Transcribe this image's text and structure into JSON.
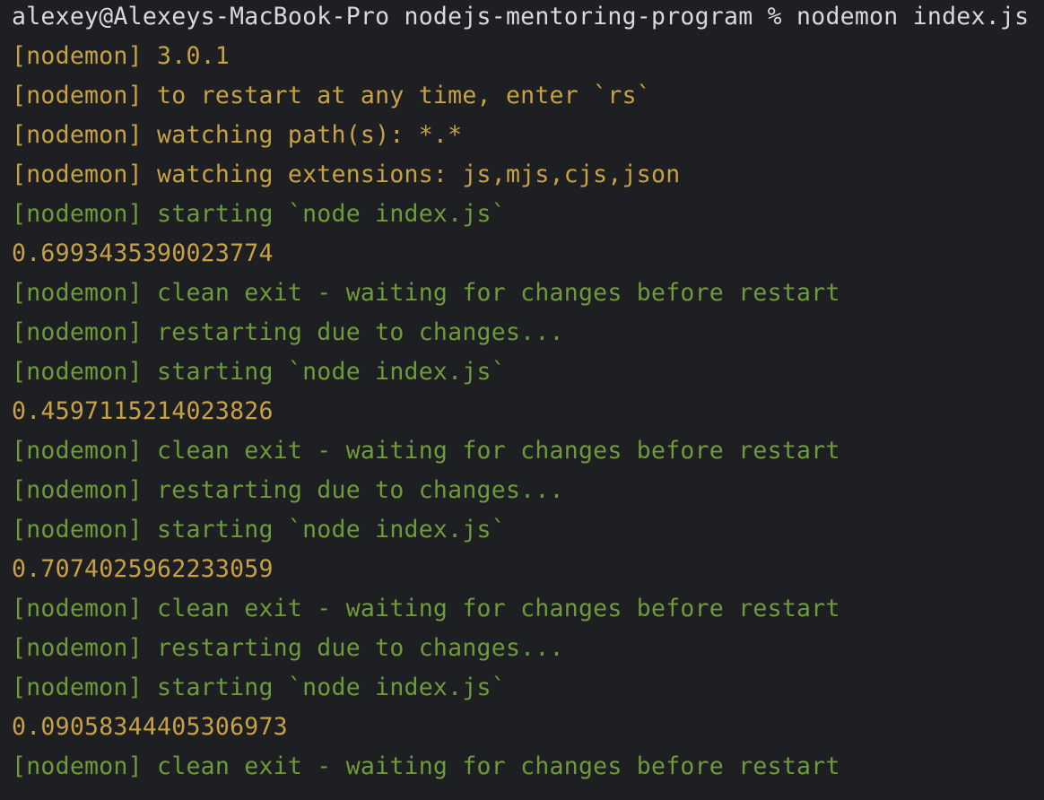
{
  "colors": {
    "background": "#1e1f22",
    "prompt": "#d7d9dd",
    "yellow": "#c7a245",
    "green": "#6e9a3c"
  },
  "terminal": {
    "prompt_line": "alexey@Alexeys-MacBook-Pro nodejs-mentoring-program % nodemon index.js",
    "lines": [
      {
        "text": "[nodemon] 3.0.1",
        "color": "yellow"
      },
      {
        "text": "[nodemon] to restart at any time, enter `rs`",
        "color": "yellow"
      },
      {
        "text": "[nodemon] watching path(s): *.*",
        "color": "yellow"
      },
      {
        "text": "[nodemon] watching extensions: js,mjs,cjs,json",
        "color": "yellow"
      },
      {
        "text": "[nodemon] starting `node index.js`",
        "color": "green"
      },
      {
        "text": "0.6993435390023774",
        "color": "yellow"
      },
      {
        "text": "[nodemon] clean exit - waiting for changes before restart",
        "color": "green"
      },
      {
        "text": "[nodemon] restarting due to changes...",
        "color": "green"
      },
      {
        "text": "[nodemon] starting `node index.js`",
        "color": "green"
      },
      {
        "text": "0.4597115214023826",
        "color": "yellow"
      },
      {
        "text": "[nodemon] clean exit - waiting for changes before restart",
        "color": "green"
      },
      {
        "text": "[nodemon] restarting due to changes...",
        "color": "green"
      },
      {
        "text": "[nodemon] starting `node index.js`",
        "color": "green"
      },
      {
        "text": "0.7074025962233059",
        "color": "yellow"
      },
      {
        "text": "[nodemon] clean exit - waiting for changes before restart",
        "color": "green"
      },
      {
        "text": "[nodemon] restarting due to changes...",
        "color": "green"
      },
      {
        "text": "[nodemon] starting `node index.js`",
        "color": "green"
      },
      {
        "text": "0.09058344405306973",
        "color": "yellow"
      },
      {
        "text": "[nodemon] clean exit - waiting for changes before restart",
        "color": "green"
      }
    ]
  }
}
